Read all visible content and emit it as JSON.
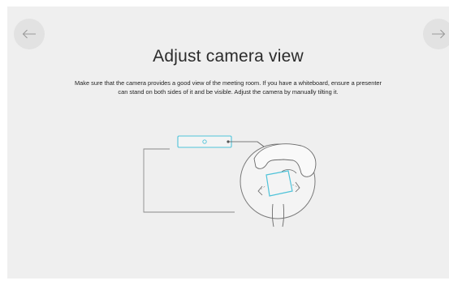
{
  "navigation": {
    "back_icon": "arrow-left-icon",
    "next_icon": "arrow-right-icon"
  },
  "page": {
    "title": "Adjust camera view",
    "description": "Make sure that the camera provides a good view of the meeting room. If you have a whiteboard, ensure a presenter can stand on both sides of it and be visible. Adjust the camera by manually tilting it."
  },
  "illustration": {
    "name": "camera-tilt-illustration",
    "accent_color": "#4fc3d9",
    "line_color": "#8a8a8a"
  }
}
